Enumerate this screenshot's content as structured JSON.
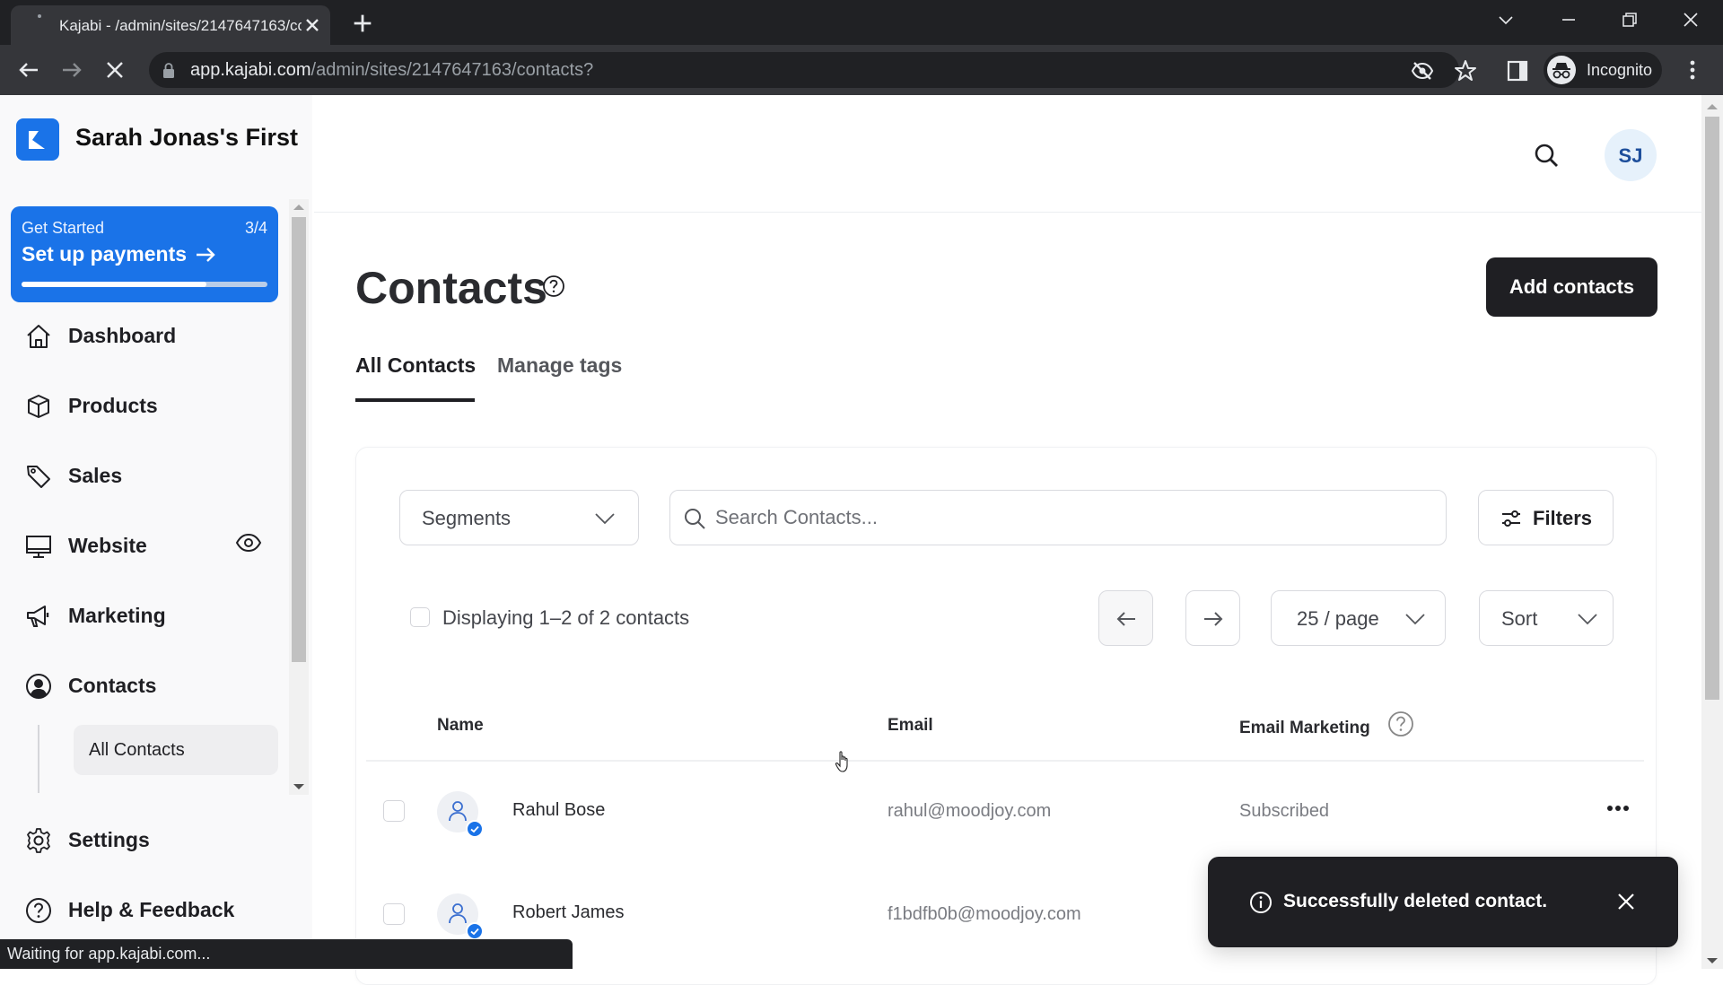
{
  "browser": {
    "tab_title": "Kajabi - /admin/sites/2147647163/contacts?",
    "url_host": "app.kajabi.com",
    "url_path": "/admin/sites/2147647163/contacts?",
    "profile_label": "Incognito",
    "status_text": "Waiting for app.kajabi.com..."
  },
  "sidebar": {
    "brand_name": "Sarah Jonas's First",
    "get_started": {
      "label": "Get Started",
      "count": "3/4",
      "action": "Set up payments",
      "progress": 0.75
    },
    "items": [
      {
        "label": "Dashboard",
        "icon": "home-icon"
      },
      {
        "label": "Products",
        "icon": "box-icon"
      },
      {
        "label": "Sales",
        "icon": "tag-icon"
      },
      {
        "label": "Website",
        "icon": "monitor-icon"
      },
      {
        "label": "Marketing",
        "icon": "megaphone-icon"
      },
      {
        "label": "Contacts",
        "icon": "user-circle-icon"
      },
      {
        "label": "Settings",
        "icon": "gear-icon"
      },
      {
        "label": "Help & Feedback",
        "icon": "help-circle-icon"
      }
    ],
    "sub_items": [
      {
        "label": "All Contacts",
        "active": true
      }
    ]
  },
  "header": {
    "avatar_initials": "SJ"
  },
  "main": {
    "title": "Contacts",
    "add_button": "Add contacts",
    "tabs": [
      {
        "label": "All Contacts",
        "active": true
      },
      {
        "label": "Manage tags",
        "active": false
      }
    ],
    "segments_label": "Segments",
    "search_placeholder": "Search Contacts...",
    "search_value": "",
    "filters_label": "Filters",
    "display_text": "Displaying 1–2 of 2 contacts",
    "per_page": "25 / page",
    "sort_label": "Sort",
    "columns": [
      "Name",
      "Email",
      "Email Marketing"
    ],
    "rows": [
      {
        "name": "Rahul Bose",
        "email": "rahul@moodjoy.com",
        "email_marketing": "Subscribed"
      },
      {
        "name": "Robert James",
        "email": "f1bdfb0b@moodjoy.com",
        "email_marketing": ""
      }
    ]
  },
  "toast": {
    "message": "Successfully deleted contact."
  },
  "colors": {
    "brand": "#1a73e8",
    "primary_button": "#1f1f23",
    "toast_bg": "#1f1f23"
  }
}
